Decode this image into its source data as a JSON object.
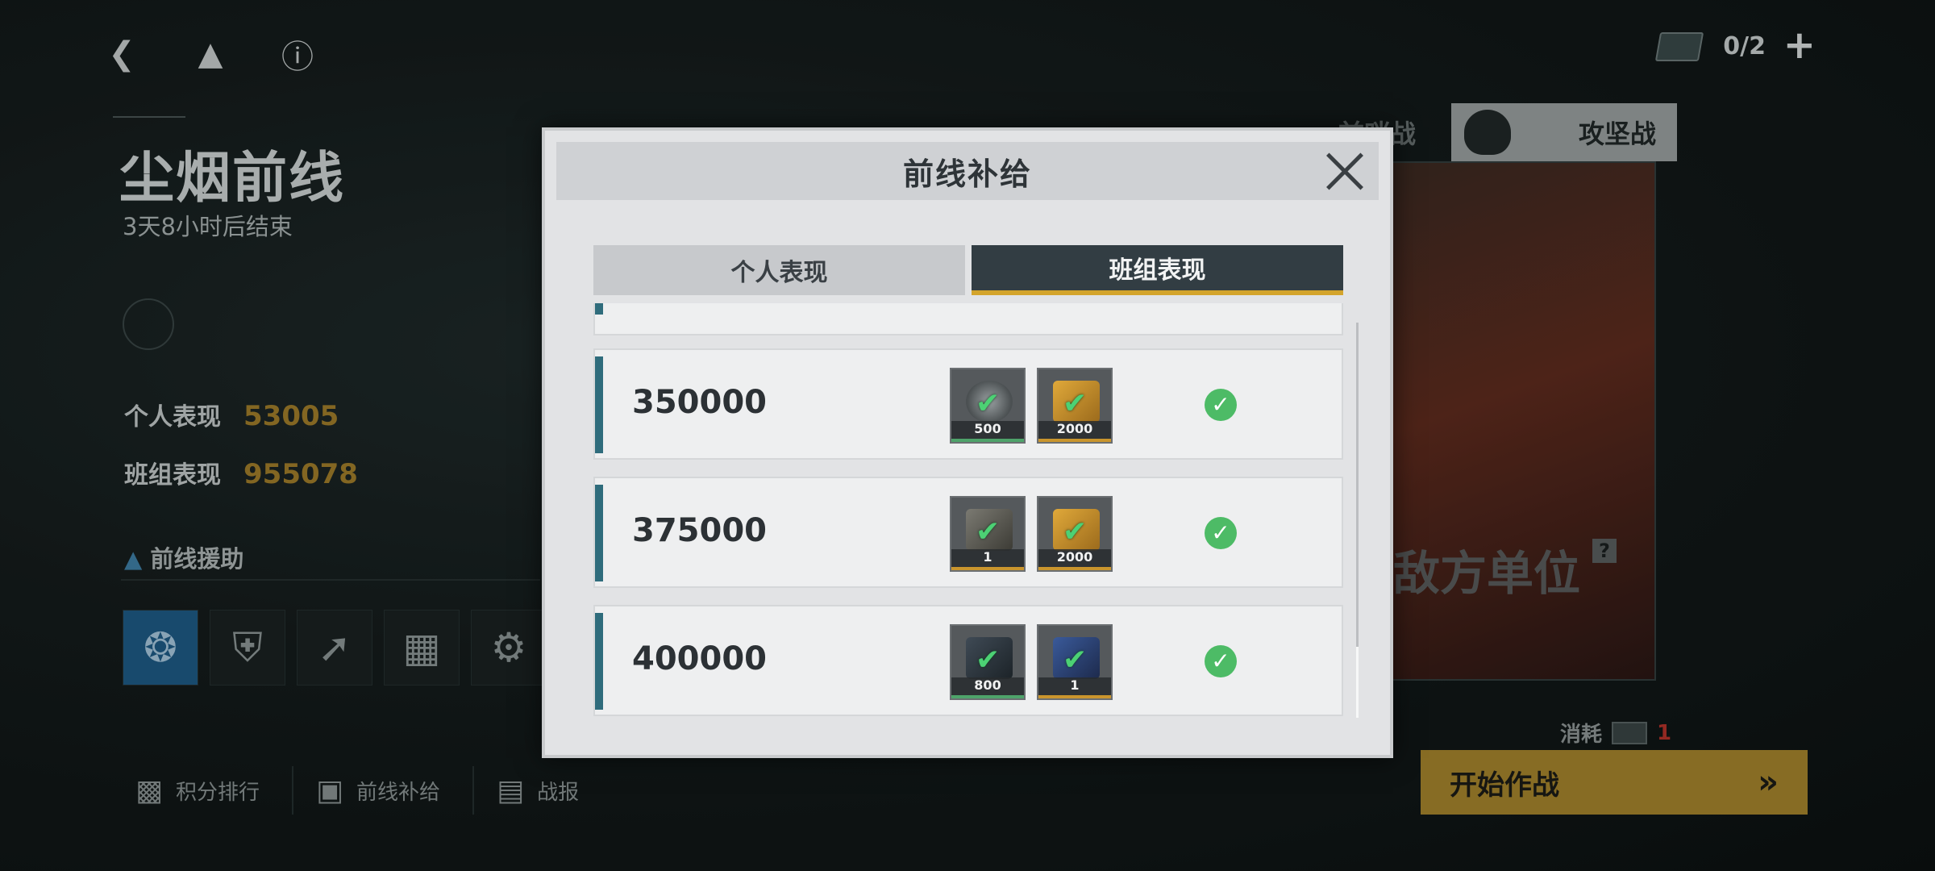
{
  "header": {
    "ticket_count": "0/2"
  },
  "event": {
    "title": "尘烟前线",
    "timer": "3天8小时后结束",
    "personal_label": "个人表现",
    "personal_value": "53005",
    "team_label": "班组表现",
    "team_value": "955078",
    "assist_title": "前线援助"
  },
  "bottom_nav": {
    "ranking": "积分排行",
    "supply": "前线补给",
    "report": "战报"
  },
  "mode": {
    "front_tab": "前哨战",
    "assault_tab": "攻坚战",
    "enemy_label": "敌方单位",
    "help": "?",
    "cost_label": "消耗",
    "cost_value": "1",
    "start_button": "开始作战"
  },
  "dialog": {
    "title": "前线补给",
    "tabs": [
      {
        "label": "个人表现",
        "active": false
      },
      {
        "label": "班组表现",
        "active": true
      }
    ],
    "rows": [
      {
        "threshold": "350000",
        "items": [
          {
            "icon": "medal-coin-icon",
            "qty": "500",
            "rarity": "green"
          },
          {
            "icon": "gold-card-icon",
            "qty": "2000",
            "rarity": "gold"
          }
        ],
        "claimed": true
      },
      {
        "threshold": "375000",
        "items": [
          {
            "icon": "manual-book-icon",
            "qty": "1",
            "rarity": "gold"
          },
          {
            "icon": "gold-card-icon",
            "qty": "2000",
            "rarity": "gold"
          }
        ],
        "claimed": true
      },
      {
        "threshold": "400000",
        "items": [
          {
            "icon": "tech-tablet-icon",
            "qty": "800",
            "rarity": "green"
          },
          {
            "icon": "mech-unit-icon",
            "qty": "1",
            "rarity": "gold"
          }
        ],
        "claimed": true
      }
    ],
    "colors": {
      "accent_tab": "#d3a42c",
      "claimed": "#4dbb66"
    }
  }
}
